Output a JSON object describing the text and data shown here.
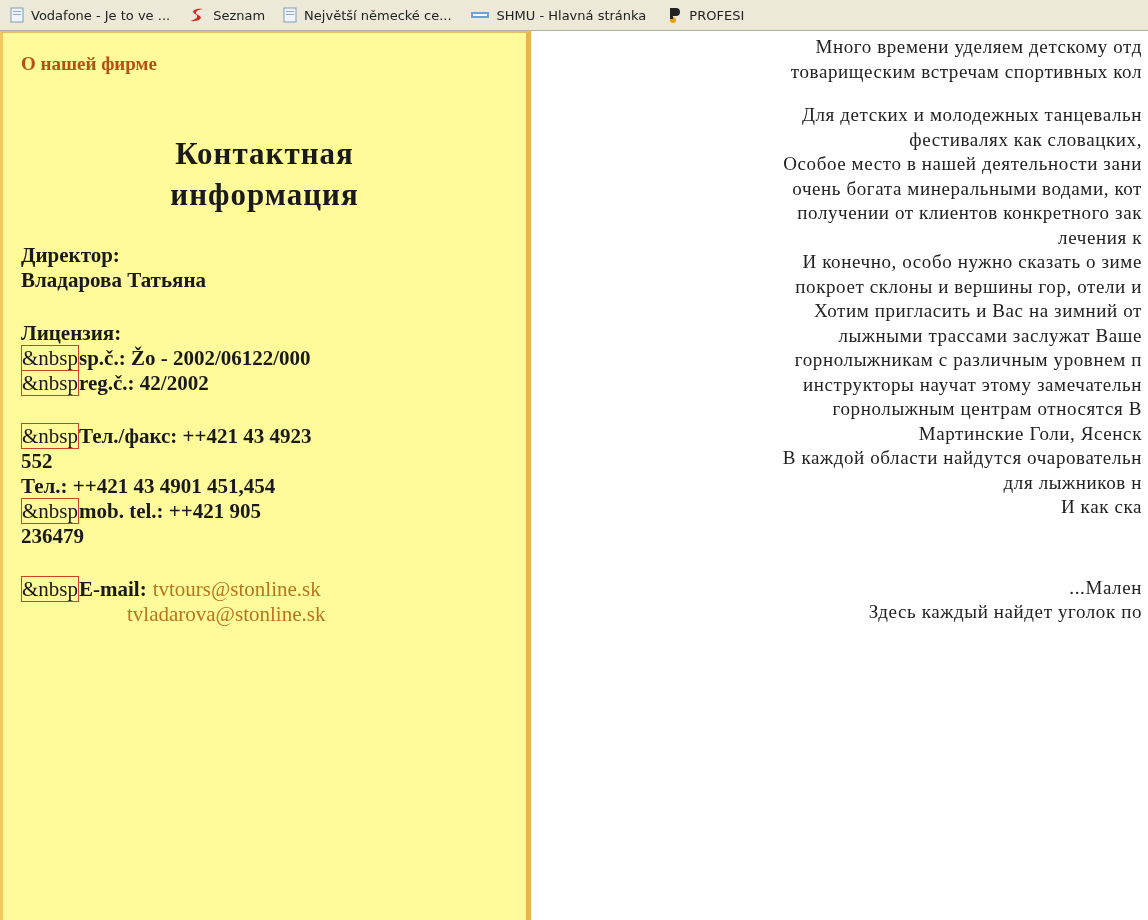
{
  "bookmarks_bar": {
    "items": [
      {
        "label": "Vodafone - Je to ve ...",
        "kind": "page"
      },
      {
        "label": "Seznam",
        "kind": "seznam"
      },
      {
        "label": "Největší německé ce...",
        "kind": "page"
      },
      {
        "label": "SHMU - Hlavná stránka",
        "kind": "shmu"
      },
      {
        "label": "PROFESI",
        "kind": "profesia"
      }
    ]
  },
  "sidebar": {
    "link": "О нашей фирме",
    "heading": "Контактная информация",
    "groups": [
      {
        "rows": [
          [
            {
              "kind": "plain",
              "text": "Директор:"
            }
          ],
          [
            {
              "kind": "plain",
              "text": "Владарова Татьяна"
            }
          ]
        ]
      },
      {
        "rows": [
          [
            {
              "kind": "plain",
              "text": "Лицензия:"
            }
          ],
          [
            {
              "kind": "flag",
              "text": "&nbsp"
            },
            {
              "kind": "plain",
              "text": "sp.č.: Žo - 2002/06122/000"
            }
          ],
          [
            {
              "kind": "flag",
              "text": "&nbsp"
            },
            {
              "kind": "plain",
              "text": "reg.č.: 42/2002"
            }
          ]
        ]
      },
      {
        "rows": [
          [
            {
              "kind": "flag",
              "text": "&nbsp"
            },
            {
              "kind": "plain",
              "text": "Тел./факс: ++421 43 4923"
            }
          ],
          [
            {
              "kind": "plain",
              "text": "552"
            }
          ],
          [
            {
              "kind": "plain",
              "text": "Тел.: ++421 43 4901 451,454"
            }
          ],
          [
            {
              "kind": "flag",
              "text": "&nbsp"
            },
            {
              "kind": "plain",
              "text": "mob. tel.: ++421 905"
            }
          ],
          [
            {
              "kind": "plain",
              "text": "236479"
            }
          ]
        ]
      },
      {
        "rows": [
          [
            {
              "kind": "flag",
              "text": "&nbsp"
            },
            {
              "kind": "plain",
              "text": "E-mail:"
            },
            {
              "kind": "link",
              "text": "tvtours@stonline.sk"
            }
          ]
        ],
        "more_links": [
          "tvladarova@stonline.sk"
        ]
      }
    ]
  },
  "article": {
    "paragraphs": [
      {
        "lines": [
          "Много времени уделяем детскому отд",
          "товарищеским встречам спортивных кол"
        ]
      },
      {
        "lines": [
          "Для детских и молодежных танцевальн",
          "фестивалях как словацких,",
          "Особое место в нашей деятельности зани",
          "очень богата минеральными водами, кот",
          "получении от клиентов конкретного зак",
          "лечения к",
          "И конечно, особо нужно сказать о зиме",
          "покроет склоны и вершины гор, отели и",
          "Хотим пригласить и Вас на зимний от",
          "лыжными трассами заслужат Ваше",
          "горнолыжникам с различным уровнем п",
          "инструкторы научат этому замечательн",
          "горнолыжным центрам относятся В",
          "Мартинские Голи, Ясенск",
          "В каждой области найдутся очаровательн",
          "для лыжников н",
          "И как ска"
        ]
      },
      {
        "lines": [
          "...Мален",
          "Здесь каждый найдет уголок по"
        ]
      }
    ]
  }
}
